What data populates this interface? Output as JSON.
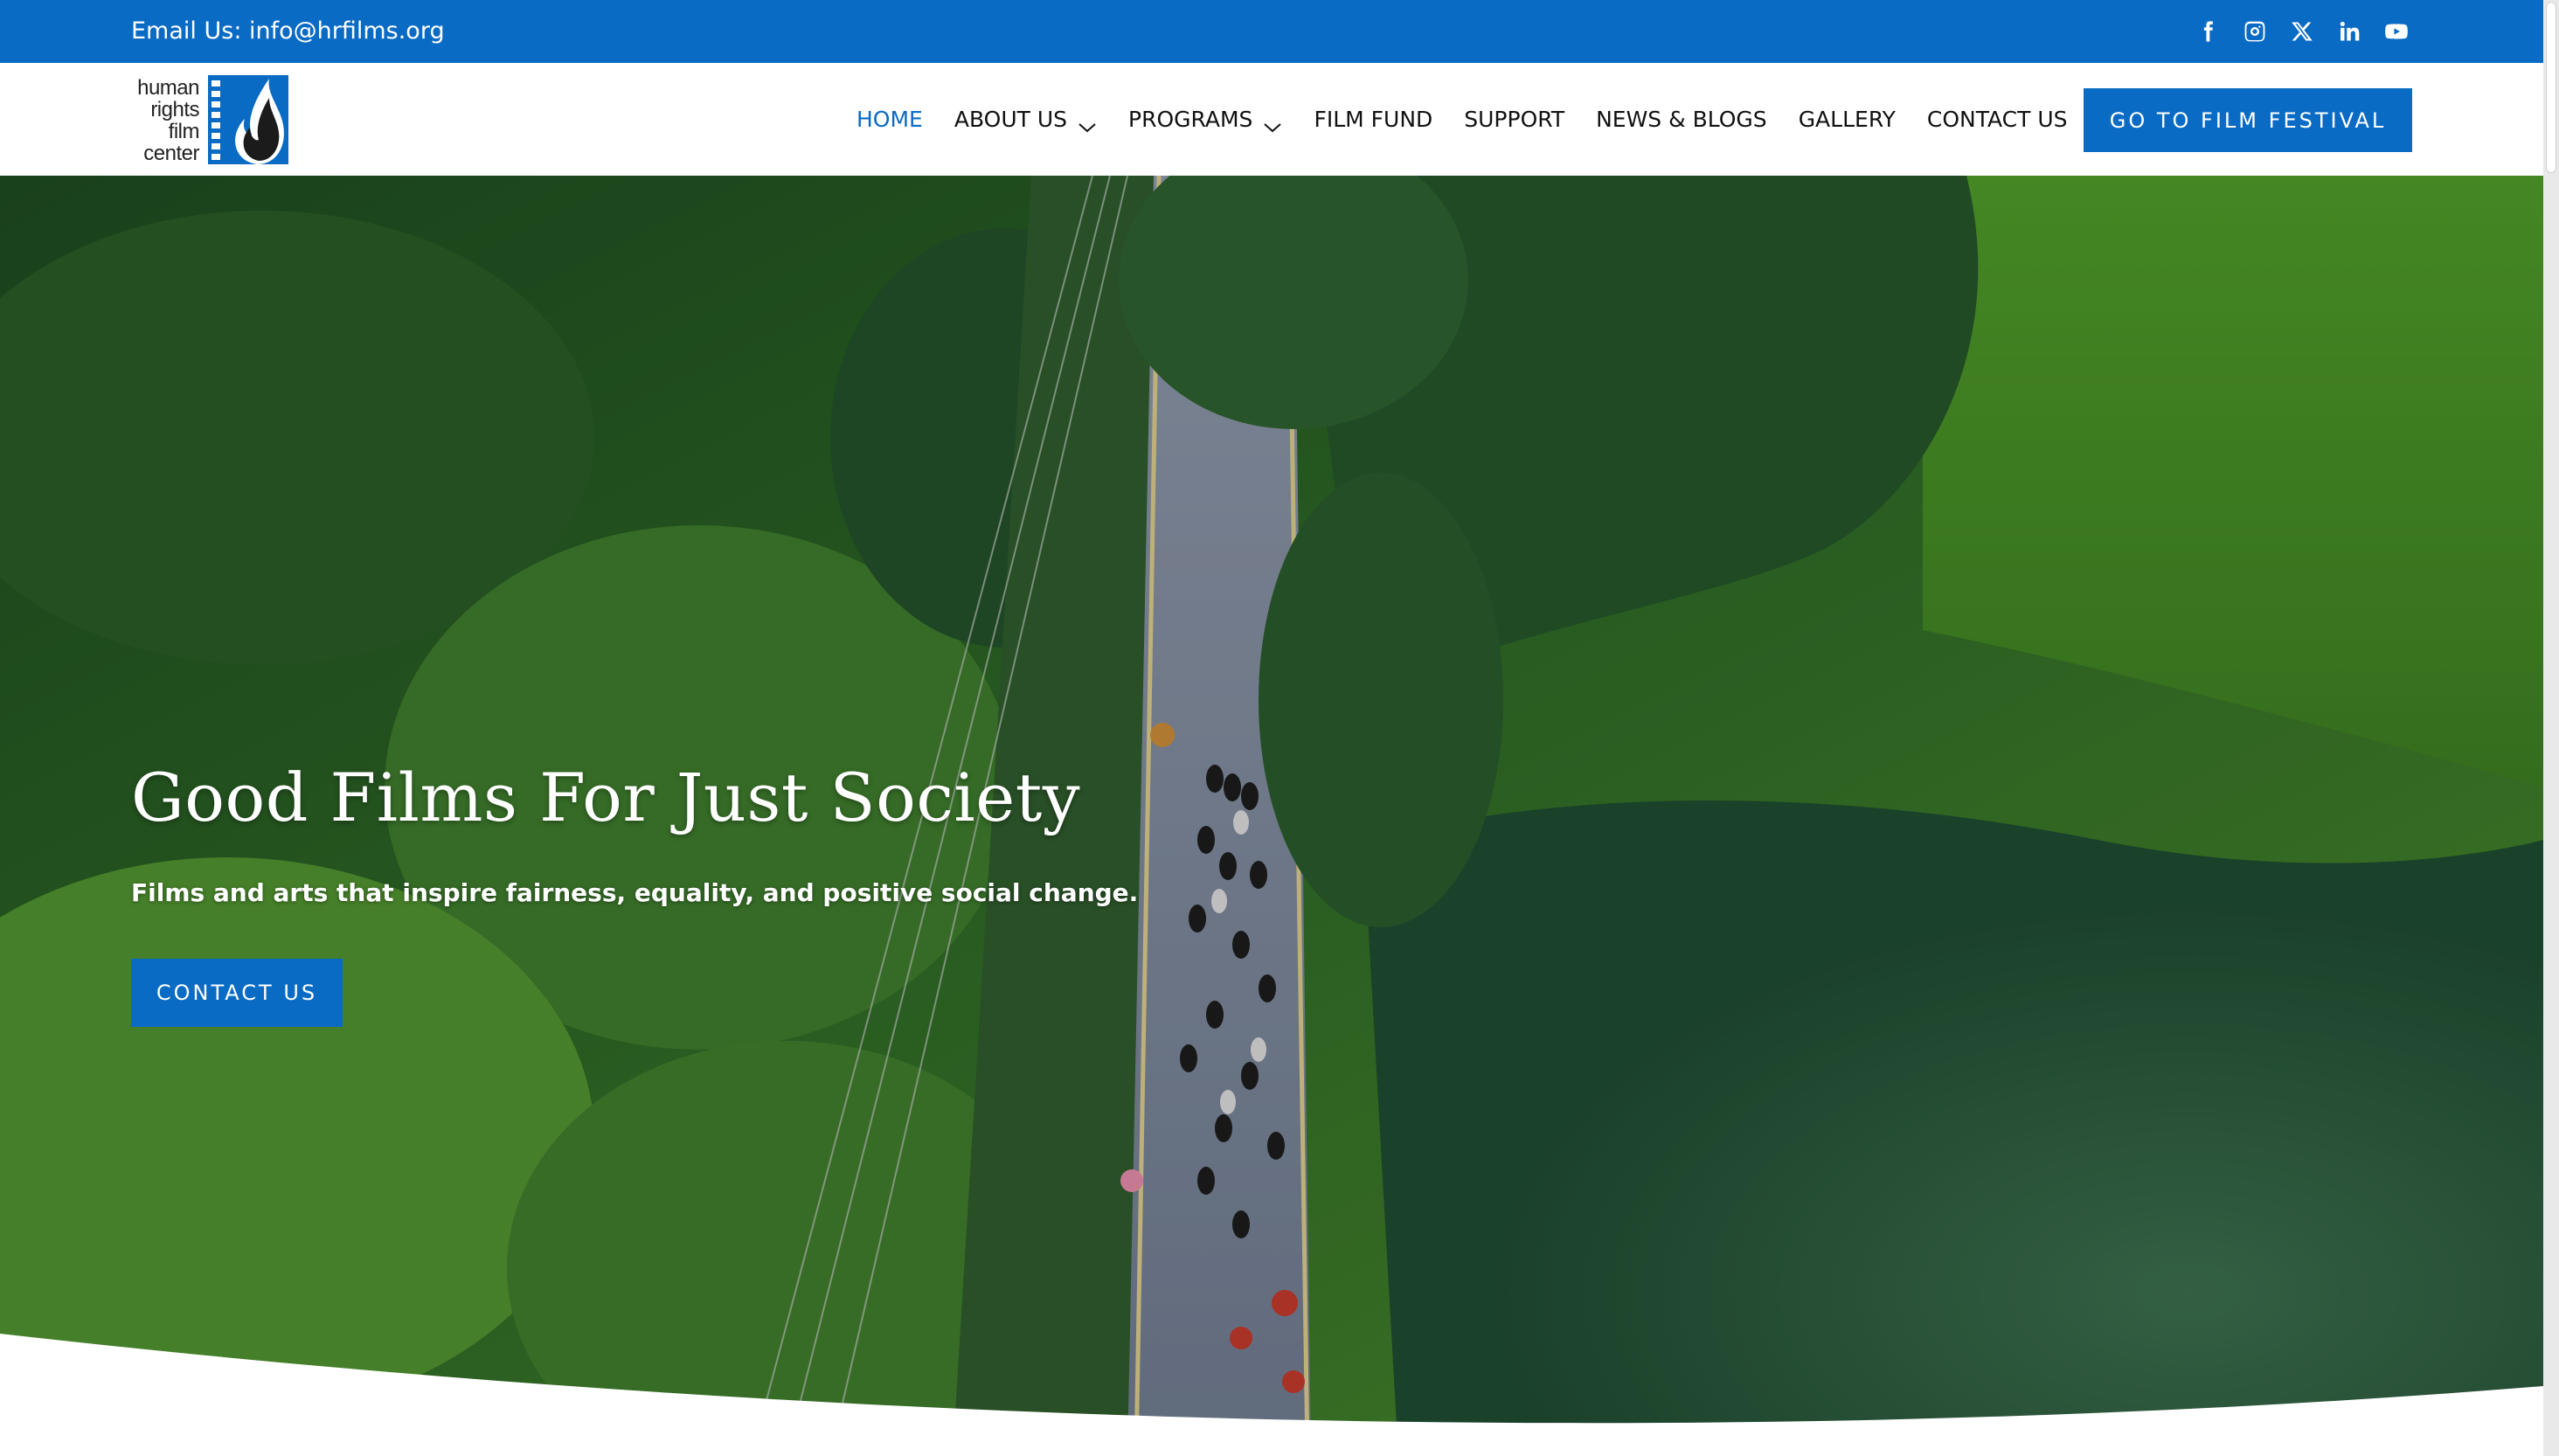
{
  "topbar": {
    "email_text": "Email Us: info@hrfilms.org",
    "social_icons": [
      "facebook-icon",
      "instagram-icon",
      "x-icon",
      "linkedin-icon",
      "youtube-icon"
    ]
  },
  "logo": {
    "lines": [
      "human",
      "rights",
      "film",
      "center"
    ]
  },
  "nav": {
    "items": [
      {
        "label": "HOME",
        "active": true,
        "has_dropdown": false
      },
      {
        "label": "ABOUT US",
        "active": false,
        "has_dropdown": true
      },
      {
        "label": "PROGRAMS",
        "active": false,
        "has_dropdown": true
      },
      {
        "label": "FILM FUND",
        "active": false,
        "has_dropdown": false
      },
      {
        "label": "SUPPORT",
        "active": false,
        "has_dropdown": false
      },
      {
        "label": "NEWS & BLOGS",
        "active": false,
        "has_dropdown": false
      },
      {
        "label": "GALLERY",
        "active": false,
        "has_dropdown": false
      },
      {
        "label": "CONTACT US",
        "active": false,
        "has_dropdown": false
      }
    ],
    "cta_label": "GO TO FILM FESTIVAL"
  },
  "hero": {
    "title": "Good Films For Just Society",
    "subtitle": "Films and arts that inspire fairness, equality, and positive social change.",
    "button_label": "CONTACT US"
  },
  "colors": {
    "brand_blue": "#0a6bc5",
    "text_dark": "#111111",
    "white": "#ffffff"
  }
}
